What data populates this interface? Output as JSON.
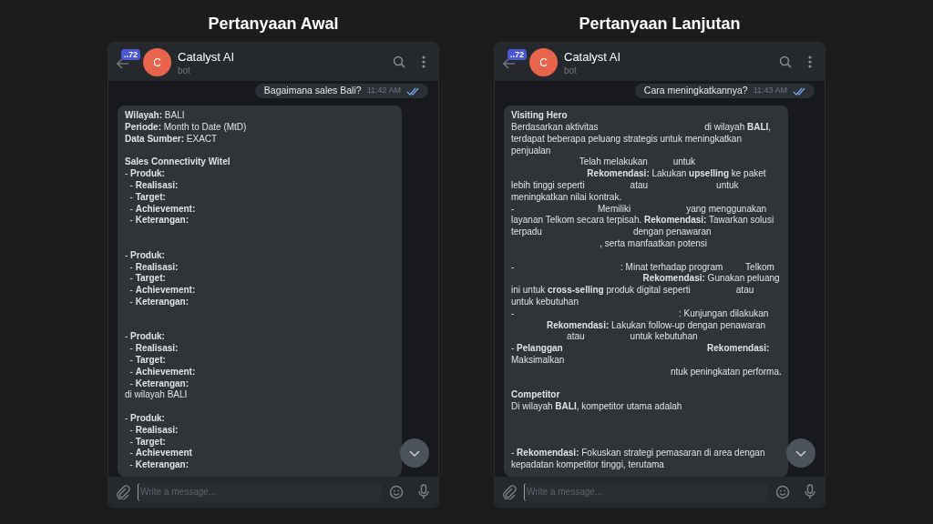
{
  "panels": [
    {
      "heading": "Pertanyaan Awal",
      "chat": {
        "unread_badge": "..72",
        "avatar_letter": "C",
        "title": "Catalyst AI",
        "subtitle": "bot",
        "messages": [
          {
            "kind": "outgoing",
            "text": "Bagaimana sales Bali?",
            "time": "11:42 AM"
          },
          {
            "kind": "incoming",
            "lines": [
              {
                "kind": "text",
                "text": "**Wilayah:** BALI"
              },
              {
                "kind": "text",
                "text": "**Periode:** Month to Date (MtD)"
              },
              {
                "kind": "text",
                "text": "**Data Sumber:** EXACT"
              },
              {
                "kind": "blank"
              },
              {
                "kind": "text",
                "text": "**Sales Connectivity Witel**"
              },
              {
                "kind": "text",
                "text": "- **Produk:**"
              },
              {
                "kind": "text",
                "text": "  - **Realisasi:**"
              },
              {
                "kind": "text",
                "text": "  - **Target:**"
              },
              {
                "kind": "text",
                "text": "  - **Achievement:**"
              },
              {
                "kind": "text",
                "text": "  - **Keterangan:**"
              },
              {
                "kind": "blank"
              },
              {
                "kind": "blank"
              },
              {
                "kind": "text",
                "text": "- **Produk:**"
              },
              {
                "kind": "text",
                "text": "  - **Realisasi:**"
              },
              {
                "kind": "text",
                "text": "  - **Target:**"
              },
              {
                "kind": "text",
                "text": "  - **Achievement:**"
              },
              {
                "kind": "text",
                "text": "  - **Keterangan:**"
              },
              {
                "kind": "blank"
              },
              {
                "kind": "blank"
              },
              {
                "kind": "text",
                "text": "- **Produk:**"
              },
              {
                "kind": "text",
                "text": "  - **Realisasi:**"
              },
              {
                "kind": "text",
                "text": "  - **Target:**"
              },
              {
                "kind": "text",
                "text": "  - **Achievement:**"
              },
              {
                "kind": "text",
                "text": "  - **Keterangan:**"
              },
              {
                "kind": "text",
                "text": "di wilayah BALI"
              },
              {
                "kind": "blank"
              },
              {
                "kind": "text",
                "text": "- **Produk:**"
              },
              {
                "kind": "text",
                "text": "  - **Realisasi:**"
              },
              {
                "kind": "text",
                "text": "  - **Target:**"
              },
              {
                "kind": "text",
                "text": "  - **Achievement**"
              },
              {
                "kind": "text",
                "text": "  - **Keterangan:**"
              }
            ]
          }
        ],
        "input": {
          "placeholder": "Write a message..."
        }
      }
    },
    {
      "heading": "Pertanyaan Lanjutan",
      "chat": {
        "unread_badge": "..72",
        "avatar_letter": "C",
        "title": "Catalyst AI",
        "subtitle": "bot",
        "messages": [
          {
            "kind": "outgoing",
            "text": "Cara meningkatkannya?",
            "time": "11:43 AM"
          },
          {
            "kind": "incoming",
            "lines": [
              {
                "kind": "text",
                "text": "**Visiting Hero**"
              },
              {
                "kind": "text",
                "text": "Berdasarkan aktivitas                                          di wilayah **BALI**,"
              },
              {
                "kind": "text",
                "text": "terdapat beberapa peluang strategis untuk meningkatkan"
              },
              {
                "kind": "text",
                "text": "penjualan"
              },
              {
                "kind": "text",
                "text": "                           Telah melakukan          untuk"
              },
              {
                "kind": "text",
                "text": "                              **Rekomendasi:** Lakukan **upselling** ke paket"
              },
              {
                "kind": "text",
                "text": "lebih tinggi seperti                  atau                           untuk"
              },
              {
                "kind": "text",
                "text": "meningkatkan nilai kontrak."
              },
              {
                "kind": "text",
                "text": "-                                 Memiliki                      yang menggunakan"
              },
              {
                "kind": "text",
                "text": "layanan Telkom secara terpisah. **Rekomendasi:** Tawarkan solusi"
              },
              {
                "kind": "text",
                "text": "terpadu                                    dengan penawaran"
              },
              {
                "kind": "text",
                "text": "                                   , serta manfaatkan potensi"
              },
              {
                "kind": "blank"
              },
              {
                "kind": "text",
                "text": "-                                          : Minat terhadap program         Telkom"
              },
              {
                "kind": "text",
                "text": "                                                    **Rekomendasi:** Gunakan peluang"
              },
              {
                "kind": "text",
                "text": "ini untuk **cross-selling** produk digital seperti                  atau"
              },
              {
                "kind": "text",
                "text": "untuk kebutuhan"
              },
              {
                "kind": "text",
                "text": "-                                                                 : Kunjungan dilakukan"
              },
              {
                "kind": "text",
                "text": "              **Rekomendasi:** Lakukan follow-up dengan penawaran"
              },
              {
                "kind": "text",
                "text": "                      atau                  untuk kebutuhan"
              },
              {
                "kind": "text",
                "text": "- **Pelanggan**                                                         **Rekomendasi:**"
              },
              {
                "kind": "text",
                "text": "Maksimalkan"
              },
              {
                "kind": "text",
                "text": "                                                               ntuk peningkatan performa."
              },
              {
                "kind": "blank"
              },
              {
                "kind": "text",
                "text": "**Competitor**"
              },
              {
                "kind": "text",
                "text": "Di wilayah **BALI**, kompetitor utama adalah"
              },
              {
                "kind": "blank"
              },
              {
                "kind": "blank"
              },
              {
                "kind": "blank"
              },
              {
                "kind": "text",
                "text": "- **Rekomendasi:** Fokuskan strategi pemasaran di area dengan"
              },
              {
                "kind": "text",
                "text": "kepadatan kompetitor tinggi, terutama"
              }
            ]
          }
        ],
        "input": {
          "placeholder": "Write a message..."
        }
      }
    }
  ]
}
